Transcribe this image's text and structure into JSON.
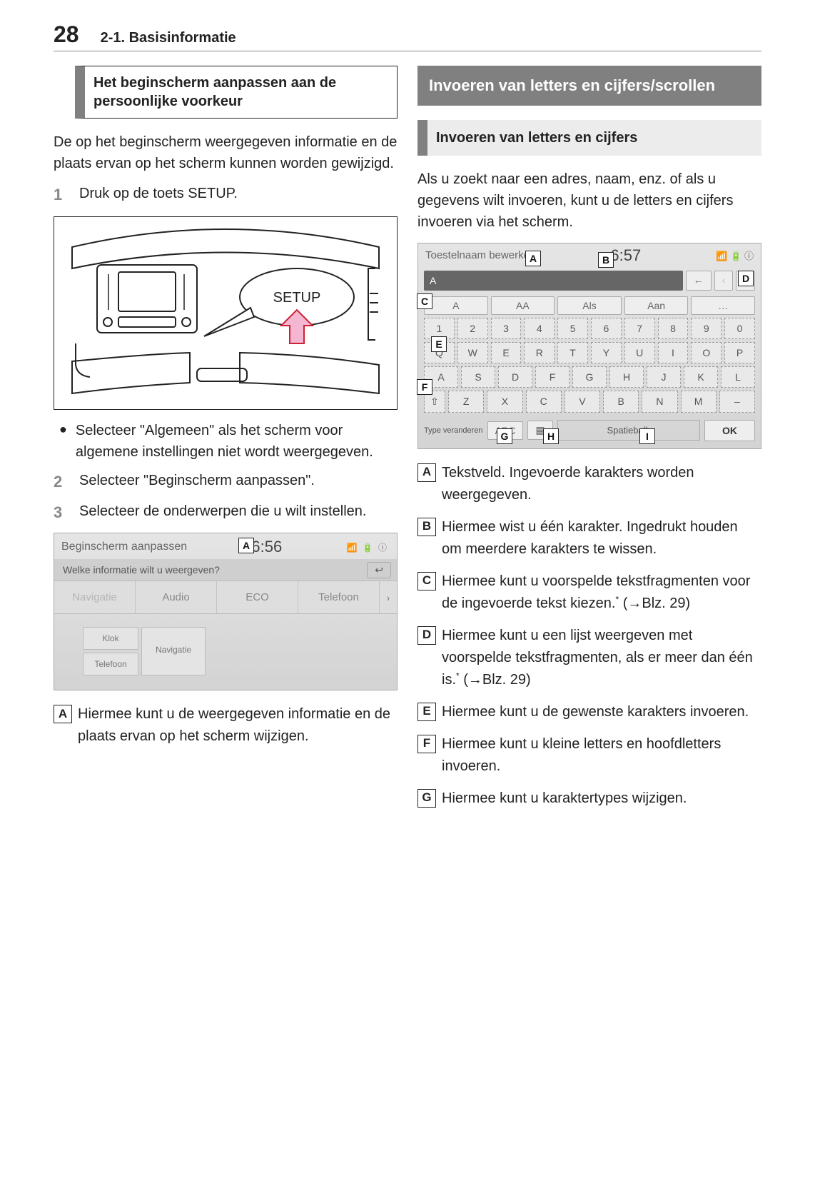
{
  "header": {
    "page_number": "28",
    "section": "2-1. Basisinformatie"
  },
  "left": {
    "heading": "Het beginscherm aanpassen aan de persoonlijke voorkeur",
    "intro": "De op het beginscherm weergegeven informatie en de plaats ervan op het scherm kunnen worden gewijzigd.",
    "step1": "Druk op de toets SETUP.",
    "setup_label": "SETUP",
    "bullet": "Selecteer \"Algemeen\" als het scherm voor algemene instellingen niet wordt weergegeven.",
    "step2": "Selecteer \"Beginscherm aanpassen\".",
    "step3": "Selecteer de onderwerpen die u wilt instellen.",
    "ui2": {
      "title": "Beginscherm aanpassen",
      "clock": "6:56",
      "status_icons": "📶 🔋 ⓘ",
      "subtitle": "Welke informatie wilt u weergeven?",
      "back_arrow": "↩",
      "callout_A": "A",
      "tabs": [
        "Navigatie",
        "Audio",
        "ECO",
        "Telefoon"
      ],
      "scroll_arrow": "›",
      "slots": {
        "klok": "Klok",
        "telefoon": "Telefoon",
        "navigatie": "Navigatie"
      }
    },
    "call_A": "Hiermee kunt u de weergegeven informatie en de plaats ervan op het scherm wijzigen."
  },
  "right": {
    "band": "Invoeren van letters en cijfers/scrollen",
    "sub": "Invoeren van letters en cijfers",
    "intro": "Als u zoekt naar een adres, naam, enz. of als u gegevens wilt invoeren, kunt u de letters en cijfers invoeren via het scherm.",
    "kb": {
      "title": "Toestelnaam bewerken",
      "clock": "6:57",
      "status_icons": "📶 🔋 ⓘ",
      "input_value": "A",
      "backspace": "←",
      "prev": "‹",
      "next": "›",
      "sugg": [
        "A",
        "AA",
        "Als",
        "Aan",
        "…"
      ],
      "row1": [
        "1",
        "2",
        "3",
        "4",
        "5",
        "6",
        "7",
        "8",
        "9",
        "0"
      ],
      "row2": [
        "Q",
        "W",
        "E",
        "R",
        "T",
        "Y",
        "U",
        "I",
        "O",
        "P"
      ],
      "row3": [
        "A",
        "S",
        "D",
        "F",
        "G",
        "H",
        "J",
        "K",
        "L"
      ],
      "row4_shift": "⇧",
      "row4": [
        "Z",
        "X",
        "C",
        "V",
        "B",
        "N",
        "M",
        "–"
      ],
      "bottom": {
        "type_change": "Type veranderen",
        "abc": "ABC",
        "hash": "▦",
        "space": "Spatiebalk",
        "ok": "OK"
      },
      "overlay": {
        "A": "A",
        "B": "B",
        "C": "C",
        "D": "D",
        "E": "E",
        "F": "F",
        "G": "G",
        "H": "H",
        "I": "I"
      }
    },
    "items": {
      "A": "Tekstveld. Ingevoerde karakters worden weergegeven.",
      "B": "Hiermee wist u één karakter. Ingedrukt houden om meerdere karakters te wissen.",
      "C_pre": "Hiermee kunt u voorspelde tekstfragmenten voor de ingevoerde tekst kiezen.",
      "C_ref": " (→Blz. 29)",
      "D_pre": "Hiermee kunt u een lijst weergeven met voorspelde tekstfragmenten, als er meer dan één is.",
      "D_ref": " (→Blz. 29)",
      "E": "Hiermee kunt u de gewenste karakters invoeren.",
      "F": "Hiermee kunt u kleine letters en hoofdletters invoeren.",
      "G": "Hiermee kunt u karaktertypes wijzigen."
    },
    "letters": {
      "A": "A",
      "B": "B",
      "C": "C",
      "D": "D",
      "E": "E",
      "F": "F",
      "G": "G"
    }
  }
}
